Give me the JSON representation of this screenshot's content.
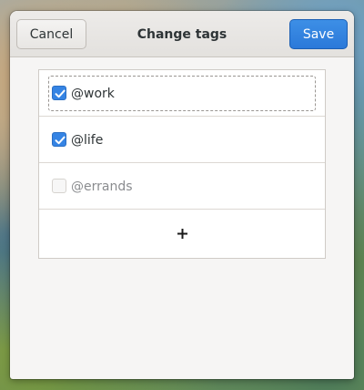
{
  "dialog": {
    "title": "Change tags",
    "cancel_label": "Cancel",
    "save_label": "Save"
  },
  "tags": [
    {
      "label": "@work",
      "checked": true
    },
    {
      "label": "@life",
      "checked": true
    },
    {
      "label": "@errands",
      "checked": false
    }
  ],
  "add_row": {
    "icon": "plus-icon"
  },
  "colors": {
    "accent": "#3584e4",
    "dialog_bg": "#f6f5f4"
  }
}
